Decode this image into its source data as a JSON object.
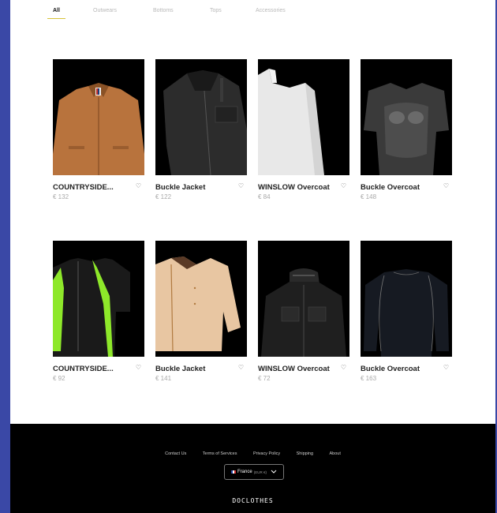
{
  "tabs": [
    {
      "label": "All",
      "active": true
    },
    {
      "label": "Outwears",
      "active": false
    },
    {
      "label": "Bottoms",
      "active": false
    },
    {
      "label": "Tops",
      "active": false
    },
    {
      "label": "Accessories",
      "active": false
    }
  ],
  "products": [
    {
      "name": "COUNTRYSIDE...",
      "price": "€ 132",
      "image": "tan-jacket"
    },
    {
      "name": "Buckle Jacket",
      "price": "€ 122",
      "image": "black-jacket"
    },
    {
      "name": "WINSLOW Overcoat",
      "price": "€ 84",
      "image": "white-longsleeve"
    },
    {
      "name": "Buckle Overcoat",
      "price": "€ 148",
      "image": "mesh-top"
    },
    {
      "name": "COUNTRYSIDE...",
      "price": "€ 92",
      "image": "neon-cycling-jersey"
    },
    {
      "name": "Buckle Jacket",
      "price": "€ 141",
      "image": "beige-cropped-jacket"
    },
    {
      "name": "WINSLOW Overcoat",
      "price": "€ 72",
      "image": "black-tactical-jacket"
    },
    {
      "name": "Buckle Overcoat",
      "price": "€ 163",
      "image": "black-compression-top"
    }
  ],
  "heart_icon": "♡",
  "footer": {
    "links": [
      "Contact Us",
      "Terms of Services",
      "Privacy Policy",
      "Shipping",
      "About"
    ],
    "locale": {
      "country": "France",
      "currency": "(EUR €)"
    },
    "brand": "DOCLOTHES"
  },
  "colors": {
    "accent_underline": "#d6c33a",
    "footer_bg": "#000000",
    "backdrop": "#3a48a6"
  }
}
